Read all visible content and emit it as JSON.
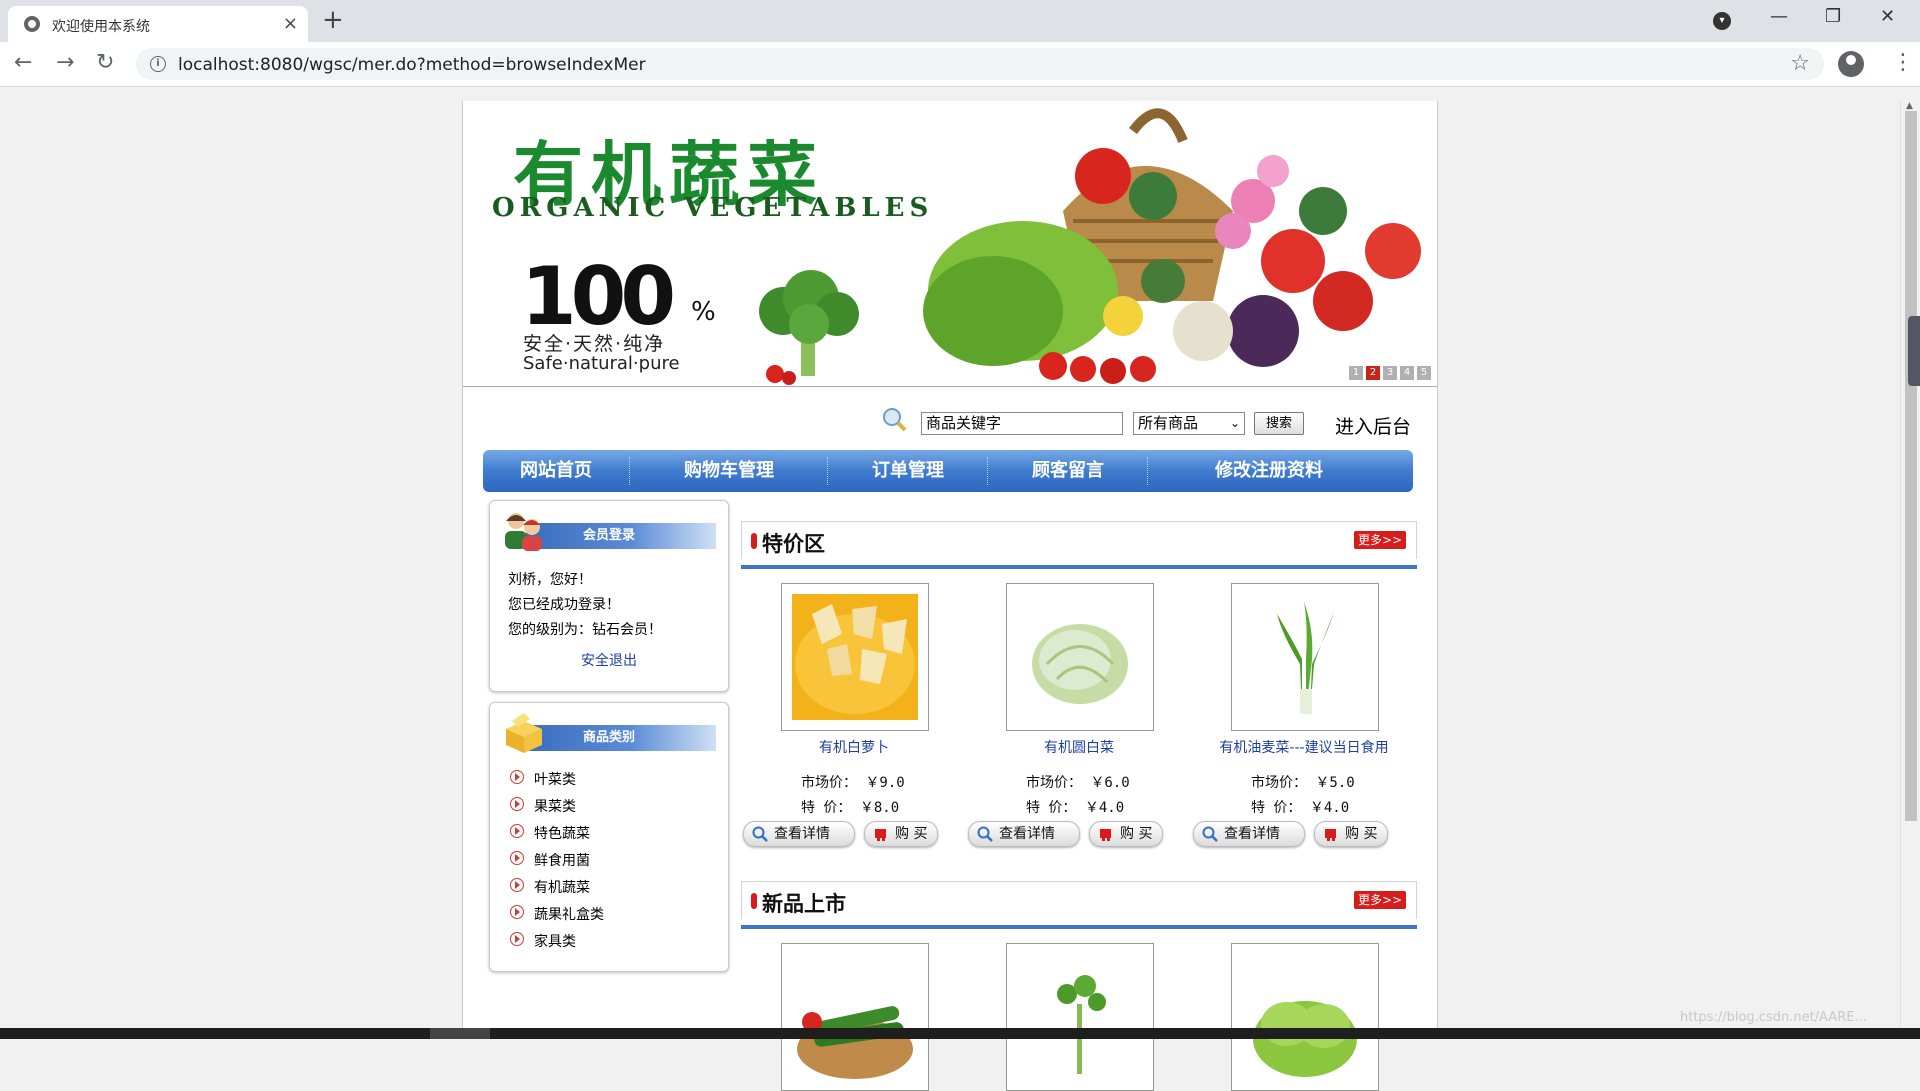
{
  "browser": {
    "tab_title": "欢迎使用本系统",
    "tab_close": "×",
    "new_tab": "+",
    "url": "localhost:8080/wgsc/mer.do?method=browseIndexMer",
    "back": "←",
    "forward": "→",
    "reload": "↻",
    "star": "☆",
    "minimize": "—",
    "restore": "❐",
    "close_window": "✕",
    "kebab": "⋮"
  },
  "banner": {
    "title_cn": "有机蔬菜",
    "title_en": "ORGANIC VEGETABLES",
    "big_number": "100",
    "percent": "%",
    "slogan_cn": "安全·天然·纯净",
    "slogan_en": "Safe·natural·pure",
    "pager": [
      "1",
      "2",
      "3",
      "4",
      "5"
    ],
    "pager_active": 2
  },
  "search": {
    "keyword": "商品关键字",
    "category_selected": "所有商品",
    "button": "搜索",
    "admin_link": "进入后台"
  },
  "nav": {
    "items": [
      "网站首页",
      "购物车管理",
      "订单管理",
      "顾客留言",
      "修改注册资料"
    ]
  },
  "login_box": {
    "title": "会员登录",
    "greeting": "刘桥，您好！",
    "status": "您已经成功登录！",
    "level": "您的级别为：钻石会员！",
    "logout": "安全退出"
  },
  "category_box": {
    "title": "商品类别",
    "items": [
      "叶菜类",
      "果菜类",
      "特色蔬菜",
      "鲜食用菌",
      "有机蔬菜",
      "蔬果礼盒类",
      "家具类"
    ]
  },
  "specials": {
    "title": "特价区",
    "more": "更多>>",
    "products": [
      {
        "name": "有机白萝卜",
        "market_price": "市场价： ￥9.0",
        "special_price": "特  价： ￥8.0"
      },
      {
        "name": "有机圆白菜",
        "market_price": "市场价： ￥6.0",
        "special_price": "特  价： ￥4.0"
      },
      {
        "name": "有机油麦菜---建议当日食用",
        "market_price": "市场价： ￥5.0",
        "special_price": "特  价： ￥4.0"
      }
    ],
    "detail_button": "查看详情",
    "buy_button": "购 买"
  },
  "new_arrivals": {
    "title": "新品上市",
    "more": "更多>>"
  },
  "watermark": "https://blog.csdn.net/AARE..."
}
